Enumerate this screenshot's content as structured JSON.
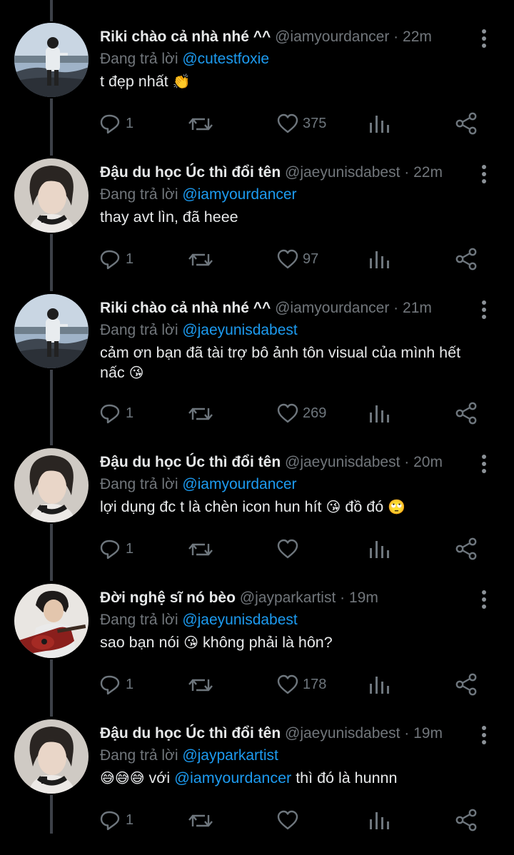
{
  "colors": {
    "background": "#000000",
    "name": "#e7e9ea",
    "muted": "#71767b",
    "mention": "#1d9bf0",
    "thread_line": "#3d4148"
  },
  "reply_prefix": "Đang trả lời",
  "tweets": [
    {
      "name": "Riki chào cả nhà nhé ^^",
      "handle": "@iamyourdancer",
      "time": "22m",
      "reply_to": "@cutestfoxie",
      "text": "t đẹp nhất",
      "emoji": "👏",
      "avatar": "avatar-riki",
      "replies": "1",
      "retweets": "",
      "likes": "375"
    },
    {
      "name": "Đậu du học Úc thì đổi tên",
      "handle": "@jaeyunisdabest",
      "time": "22m",
      "reply_to": "@iamyourdancer",
      "text": "thay avt lìn, đã heee",
      "avatar": "avatar-jaeyun",
      "replies": "1",
      "retweets": "",
      "likes": "97"
    },
    {
      "name": "Riki chào cả nhà nhé ^^",
      "handle": "@iamyourdancer",
      "time": "21m",
      "reply_to": "@jaeyunisdabest",
      "text": "cảm ơn bạn đã tài trợ bô ảnh tôn visual của mình hết nấc",
      "emoji": "😘",
      "avatar": "avatar-riki",
      "replies": "1",
      "retweets": "",
      "likes": "269"
    },
    {
      "name": "Đậu du học Úc thì đổi tên",
      "handle": "@jaeyunisdabest",
      "time": "20m",
      "reply_to": "@iamyourdancer",
      "text_a": "lợi dụng đc t là chèn icon hun hít",
      "emoji_a": "😘",
      "text_b": "đồ đó",
      "emoji_b": "🙄",
      "avatar": "avatar-jaeyun",
      "replies": "1",
      "retweets": "",
      "likes": ""
    },
    {
      "name": "Đời nghệ sĩ nó bèo",
      "handle": "@jayparkartist",
      "time": "19m",
      "reply_to": "@jaeyunisdabest",
      "text_a": "sao bạn nói",
      "emoji_a": "😘",
      "text_b": "không phải là hôn?",
      "avatar": "avatar-jaypark",
      "replies": "1",
      "retweets": "",
      "likes": "178"
    },
    {
      "name": "Đậu du học Úc thì đổi tên",
      "handle": "@jaeyunisdabest",
      "time": "19m",
      "reply_to": "@jayparkartist",
      "emoji_a": "😅😅😅",
      "text_a": "với",
      "mention": "@iamyourdancer",
      "text_b": "thì đó là hunnn",
      "avatar": "avatar-jaeyun",
      "replies": "1",
      "retweets": "",
      "likes": ""
    }
  ]
}
